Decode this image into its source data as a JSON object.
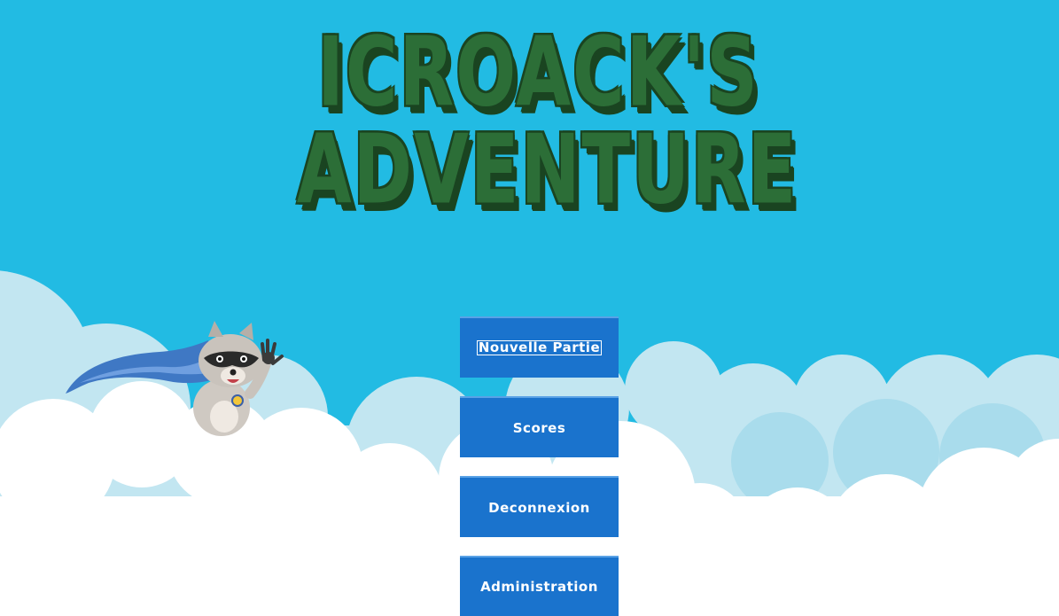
{
  "game": {
    "title_line_1": "ICROACK'S",
    "title_line_2": "ADVENTURE"
  },
  "menu": {
    "buttons": [
      {
        "label": "Nouvelle Partie",
        "focused": true
      },
      {
        "label": "Scores"
      },
      {
        "label": "Deconnexion"
      },
      {
        "label": "Administration"
      }
    ]
  },
  "colors": {
    "sky": "#22bbe3",
    "cloud_back": "#bde4f0",
    "cloud_front": "#ffffff",
    "title_green": "#2c6e37",
    "title_outline": "#1a4421",
    "button_blue": "#1a73cd"
  },
  "mascot": {
    "icon": "raccoon-hero-icon"
  }
}
